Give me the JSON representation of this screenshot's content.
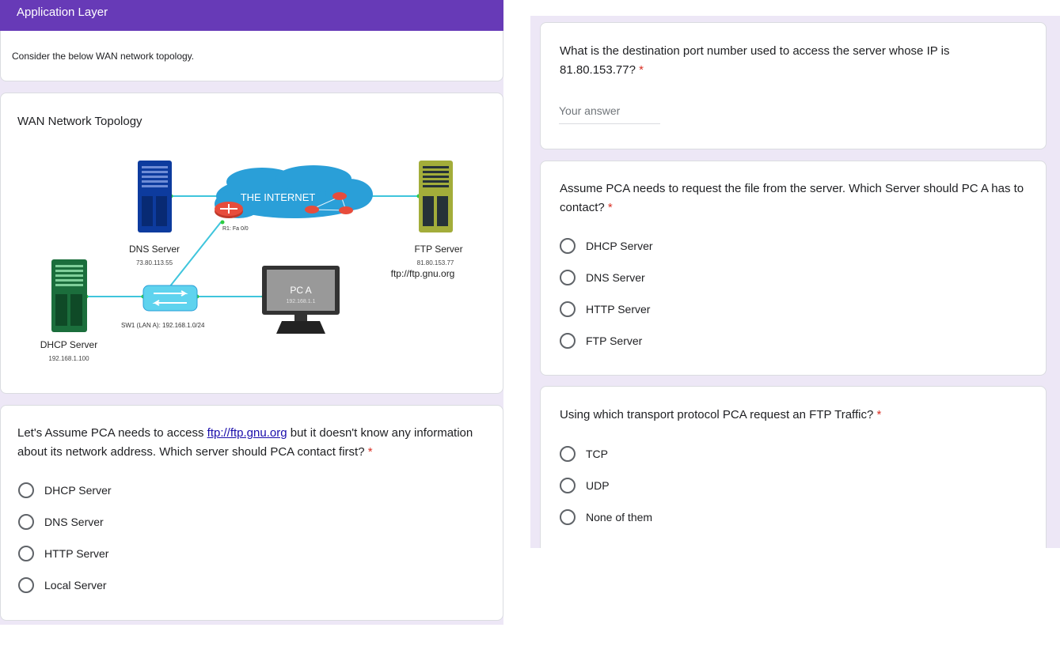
{
  "header": {
    "title": "Application Layer"
  },
  "intro": {
    "text": "Consider the below WAN network topology."
  },
  "topology": {
    "title": "WAN Network Topology",
    "internet_label": "THE INTERNET",
    "r1_label": "R1: Fa 0/0",
    "dns": {
      "name": "DNS Server",
      "ip": "73.80.113.55"
    },
    "ftp": {
      "name": "FTP Server",
      "ip": "81.80.153.77",
      "url": "ftp://ftp.gnu.org"
    },
    "pca": {
      "name": "PC A",
      "ip": "192.168.1.1"
    },
    "switch_label": "SW1 (LAN A): 192.168.1.0/24",
    "dhcp": {
      "name": "DHCP Server",
      "ip": "192.168.1.100"
    }
  },
  "q1": {
    "text_before": "Let's Assume PCA needs to access ",
    "link": "ftp://ftp.gnu.org",
    "text_after": " but it doesn't know any information about its network address. Which server should PCA contact first?",
    "required": "*",
    "options": [
      "DHCP Server",
      "DNS Server",
      "HTTP Server",
      "Local Server"
    ]
  },
  "q2": {
    "text": "What is the destination port number used to access the server whose IP is 81.80.153.77?",
    "required": "*",
    "placeholder": "Your answer"
  },
  "q3": {
    "text": "Assume PCA needs to request the file from the server. Which Server should PC A has to contact?",
    "required": "*",
    "options": [
      "DHCP Server",
      "DNS Server",
      "HTTP Server",
      "FTP Server"
    ]
  },
  "q4": {
    "text": "Using which transport protocol PCA request an FTP Traffic?",
    "required": "*",
    "options": [
      "TCP",
      "UDP",
      "None of them"
    ]
  },
  "colors": {
    "header": "#673ab7",
    "background": "#ede7f6",
    "required": "#d93025",
    "link": "#1a0dab"
  }
}
